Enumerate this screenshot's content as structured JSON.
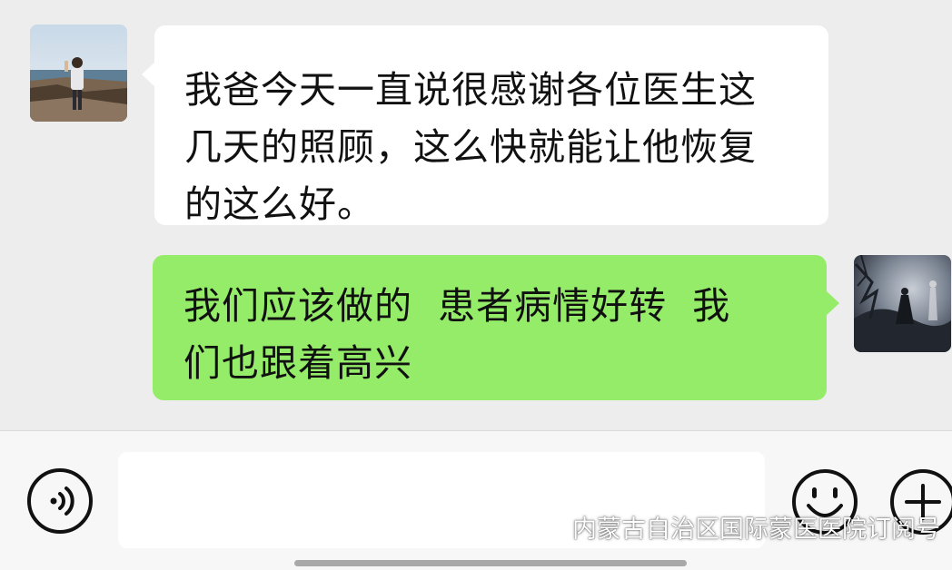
{
  "messages": [
    {
      "side": "left",
      "avatar": "person-on-beach-photo",
      "text": "我爸今天一直说很感谢各位医生这\n几天的照顾，这么快就能让他恢复\n的这么好。"
    },
    {
      "side": "right",
      "avatar": "dark-fantasy-figure-photo",
      "text": "我们应该做的  患者病情好转  我\n们也跟着高兴"
    }
  ],
  "input_bar": {
    "voice_icon": "voice-icon",
    "placeholder": "",
    "emoji_icon": "emoji-icon",
    "plus_icon": "plus-icon"
  },
  "watermark": {
    "icon": "wechat-icon",
    "text": "内蒙古自治区国际蒙医医院订阅号"
  },
  "colors": {
    "chat_background": "#ededed",
    "incoming_bubble": "#ffffff",
    "outgoing_bubble": "#95ec69",
    "input_bar": "#f7f7f7"
  }
}
